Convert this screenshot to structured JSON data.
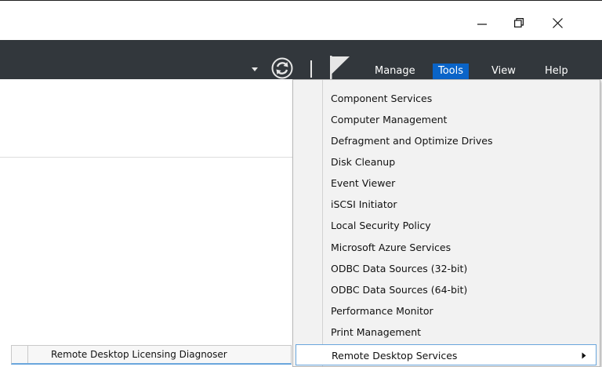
{
  "window": {
    "controls": [
      "minimize",
      "restore",
      "close"
    ]
  },
  "toolbar": {
    "menus": [
      {
        "label": "Manage"
      },
      {
        "label": "Tools"
      },
      {
        "label": "View"
      },
      {
        "label": "Help"
      }
    ],
    "active_menu": "Tools",
    "accent_color": "#0a64c8",
    "bar_color": "#32373c"
  },
  "tools_menu": {
    "items": [
      "Component Services",
      "Computer Management",
      "Defragment and Optimize Drives",
      "Disk Cleanup",
      "Event Viewer",
      "iSCSI Initiator",
      "Local Security Policy",
      "Microsoft Azure Services",
      "ODBC Data Sources (32-bit)",
      "ODBC Data Sources (64-bit)",
      "Performance Monitor",
      "Print Management",
      "Remote Desktop Services"
    ],
    "highlighted": "Remote Desktop Services"
  },
  "background_list": {
    "items": [
      "Remote Desktop Licensing Diagnoser"
    ]
  },
  "icons": {
    "dropdown": "caret-down-icon",
    "refresh": "refresh-icon",
    "flag": "notifications-flag-icon",
    "submenu": "chevron-right-icon"
  }
}
